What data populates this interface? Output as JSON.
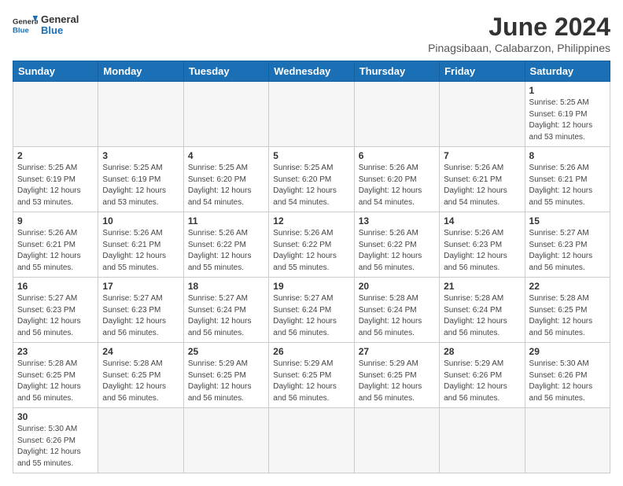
{
  "header": {
    "logo_general": "General",
    "logo_blue": "Blue",
    "title": "June 2024",
    "subtitle": "Pinagsibaan, Calabarzon, Philippines"
  },
  "days_of_week": [
    "Sunday",
    "Monday",
    "Tuesday",
    "Wednesday",
    "Thursday",
    "Friday",
    "Saturday"
  ],
  "weeks": [
    [
      {
        "day": "",
        "info": ""
      },
      {
        "day": "",
        "info": ""
      },
      {
        "day": "",
        "info": ""
      },
      {
        "day": "",
        "info": ""
      },
      {
        "day": "",
        "info": ""
      },
      {
        "day": "",
        "info": ""
      },
      {
        "day": "1",
        "info": "Sunrise: 5:25 AM\nSunset: 6:19 PM\nDaylight: 12 hours\nand 53 minutes."
      }
    ],
    [
      {
        "day": "2",
        "info": "Sunrise: 5:25 AM\nSunset: 6:19 PM\nDaylight: 12 hours\nand 53 minutes."
      },
      {
        "day": "3",
        "info": "Sunrise: 5:25 AM\nSunset: 6:19 PM\nDaylight: 12 hours\nand 53 minutes."
      },
      {
        "day": "4",
        "info": "Sunrise: 5:25 AM\nSunset: 6:20 PM\nDaylight: 12 hours\nand 54 minutes."
      },
      {
        "day": "5",
        "info": "Sunrise: 5:25 AM\nSunset: 6:20 PM\nDaylight: 12 hours\nand 54 minutes."
      },
      {
        "day": "6",
        "info": "Sunrise: 5:26 AM\nSunset: 6:20 PM\nDaylight: 12 hours\nand 54 minutes."
      },
      {
        "day": "7",
        "info": "Sunrise: 5:26 AM\nSunset: 6:21 PM\nDaylight: 12 hours\nand 54 minutes."
      },
      {
        "day": "8",
        "info": "Sunrise: 5:26 AM\nSunset: 6:21 PM\nDaylight: 12 hours\nand 55 minutes."
      }
    ],
    [
      {
        "day": "9",
        "info": "Sunrise: 5:26 AM\nSunset: 6:21 PM\nDaylight: 12 hours\nand 55 minutes."
      },
      {
        "day": "10",
        "info": "Sunrise: 5:26 AM\nSunset: 6:21 PM\nDaylight: 12 hours\nand 55 minutes."
      },
      {
        "day": "11",
        "info": "Sunrise: 5:26 AM\nSunset: 6:22 PM\nDaylight: 12 hours\nand 55 minutes."
      },
      {
        "day": "12",
        "info": "Sunrise: 5:26 AM\nSunset: 6:22 PM\nDaylight: 12 hours\nand 55 minutes."
      },
      {
        "day": "13",
        "info": "Sunrise: 5:26 AM\nSunset: 6:22 PM\nDaylight: 12 hours\nand 56 minutes."
      },
      {
        "day": "14",
        "info": "Sunrise: 5:26 AM\nSunset: 6:23 PM\nDaylight: 12 hours\nand 56 minutes."
      },
      {
        "day": "15",
        "info": "Sunrise: 5:27 AM\nSunset: 6:23 PM\nDaylight: 12 hours\nand 56 minutes."
      }
    ],
    [
      {
        "day": "16",
        "info": "Sunrise: 5:27 AM\nSunset: 6:23 PM\nDaylight: 12 hours\nand 56 minutes."
      },
      {
        "day": "17",
        "info": "Sunrise: 5:27 AM\nSunset: 6:23 PM\nDaylight: 12 hours\nand 56 minutes."
      },
      {
        "day": "18",
        "info": "Sunrise: 5:27 AM\nSunset: 6:24 PM\nDaylight: 12 hours\nand 56 minutes."
      },
      {
        "day": "19",
        "info": "Sunrise: 5:27 AM\nSunset: 6:24 PM\nDaylight: 12 hours\nand 56 minutes."
      },
      {
        "day": "20",
        "info": "Sunrise: 5:28 AM\nSunset: 6:24 PM\nDaylight: 12 hours\nand 56 minutes."
      },
      {
        "day": "21",
        "info": "Sunrise: 5:28 AM\nSunset: 6:24 PM\nDaylight: 12 hours\nand 56 minutes."
      },
      {
        "day": "22",
        "info": "Sunrise: 5:28 AM\nSunset: 6:25 PM\nDaylight: 12 hours\nand 56 minutes."
      }
    ],
    [
      {
        "day": "23",
        "info": "Sunrise: 5:28 AM\nSunset: 6:25 PM\nDaylight: 12 hours\nand 56 minutes."
      },
      {
        "day": "24",
        "info": "Sunrise: 5:28 AM\nSunset: 6:25 PM\nDaylight: 12 hours\nand 56 minutes."
      },
      {
        "day": "25",
        "info": "Sunrise: 5:29 AM\nSunset: 6:25 PM\nDaylight: 12 hours\nand 56 minutes."
      },
      {
        "day": "26",
        "info": "Sunrise: 5:29 AM\nSunset: 6:25 PM\nDaylight: 12 hours\nand 56 minutes."
      },
      {
        "day": "27",
        "info": "Sunrise: 5:29 AM\nSunset: 6:25 PM\nDaylight: 12 hours\nand 56 minutes."
      },
      {
        "day": "28",
        "info": "Sunrise: 5:29 AM\nSunset: 6:26 PM\nDaylight: 12 hours\nand 56 minutes."
      },
      {
        "day": "29",
        "info": "Sunrise: 5:30 AM\nSunset: 6:26 PM\nDaylight: 12 hours\nand 56 minutes."
      }
    ],
    [
      {
        "day": "30",
        "info": "Sunrise: 5:30 AM\nSunset: 6:26 PM\nDaylight: 12 hours\nand 55 minutes."
      },
      {
        "day": "",
        "info": ""
      },
      {
        "day": "",
        "info": ""
      },
      {
        "day": "",
        "info": ""
      },
      {
        "day": "",
        "info": ""
      },
      {
        "day": "",
        "info": ""
      },
      {
        "day": "",
        "info": ""
      }
    ]
  ]
}
